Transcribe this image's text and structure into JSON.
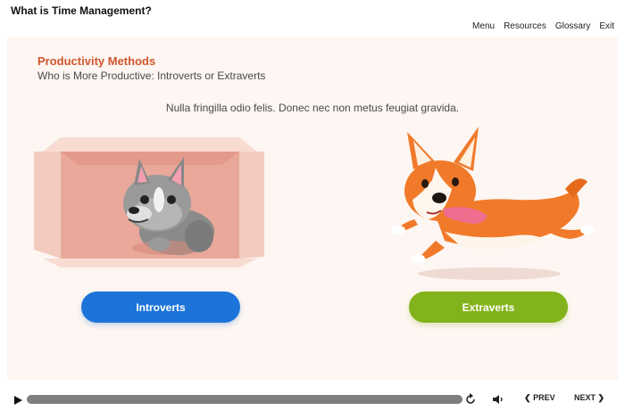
{
  "course": {
    "title": "What is Time Management?"
  },
  "nav": {
    "menu": "Menu",
    "resources": "Resources",
    "glossary": "Glossary",
    "exit": "Exit"
  },
  "slide": {
    "section_title": "Productivity Methods",
    "subtitle": "Who is More Productive: Introverts or Extraverts",
    "body": "Nulla fringilla odio felis. Donec nec non metus feugiat gravida."
  },
  "choices": {
    "introverts": "Introverts",
    "extraverts": "Extraverts"
  },
  "player": {
    "prev_label": "PREV",
    "next_label": "NEXT",
    "progress": 0.0
  },
  "icons": {
    "play": "play-icon",
    "replay": "replay-icon",
    "volume": "volume-icon",
    "prev": "chevron-left-icon",
    "next": "chevron-right-icon"
  },
  "colors": {
    "title_accent": "#d0552c",
    "introverts_button": "#1c74d9",
    "extraverts_button": "#83b31c",
    "slide_bg": "#fdf6f2",
    "seek_bar": "#7e7e7e"
  }
}
